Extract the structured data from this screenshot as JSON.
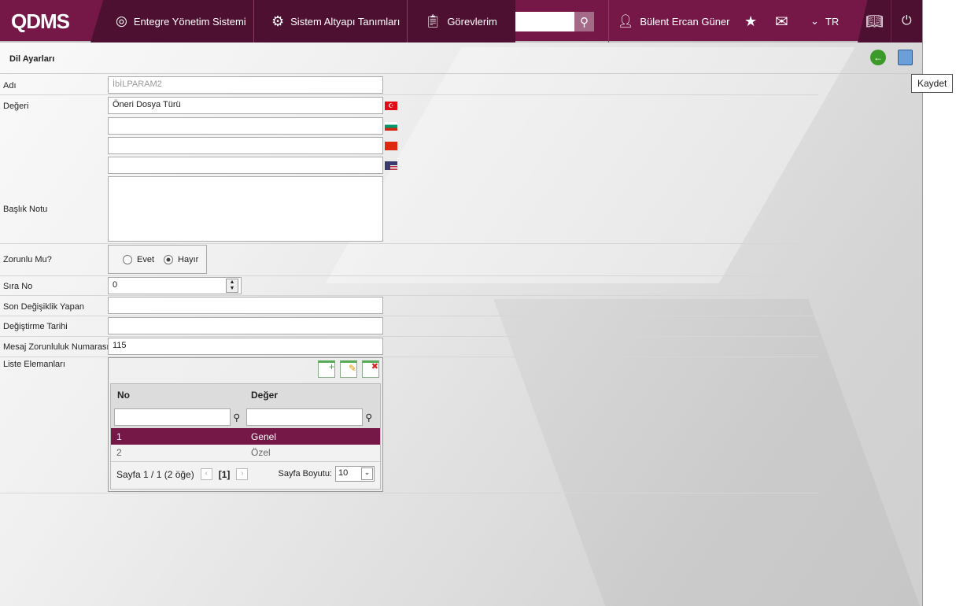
{
  "header": {
    "logo": "QDMS",
    "nav": [
      "Entegre Yönetim Sistemi",
      "Sistem Altyapı Tanımları",
      "Görevlerim"
    ],
    "user": "Bülent Ercan Güner",
    "lang": "TR"
  },
  "page": {
    "title": "Dil Ayarları",
    "save_tooltip": "Kaydet"
  },
  "form": {
    "adi_label": "Adı",
    "adi_value": "İbİLPARAM2",
    "degeri_label": "Değeri",
    "degeri_tr": "Öneri Dosya Türü",
    "degeri_bg": "",
    "degeri_cn": "",
    "degeri_en": "",
    "baslik_label": "Başlık Notu",
    "zorunlu_label": "Zorunlu Mu?",
    "evet": "Evet",
    "hayir": "Hayır",
    "sira_label": "Sıra No",
    "sira_value": "0",
    "son_label": "Son Değişiklik Yapan",
    "tarih_label": "Değiştirme Tarihi",
    "mesaj_label": "Mesaj Zorunluluk Numarası",
    "mesaj_value": "115",
    "liste_label": "Liste Elemanları"
  },
  "grid": {
    "col_no": "No",
    "col_deger": "Değer",
    "rows": [
      {
        "no": "1",
        "deger": "Genel"
      },
      {
        "no": "2",
        "deger": "Özel"
      }
    ],
    "page_info": "Sayfa 1 / 1 (2 öğe)",
    "current": "[1]",
    "size_label": "Sayfa Boyutu:",
    "size": "10"
  },
  "colors": {
    "brand": "#751848",
    "dark": "#4e1030"
  }
}
